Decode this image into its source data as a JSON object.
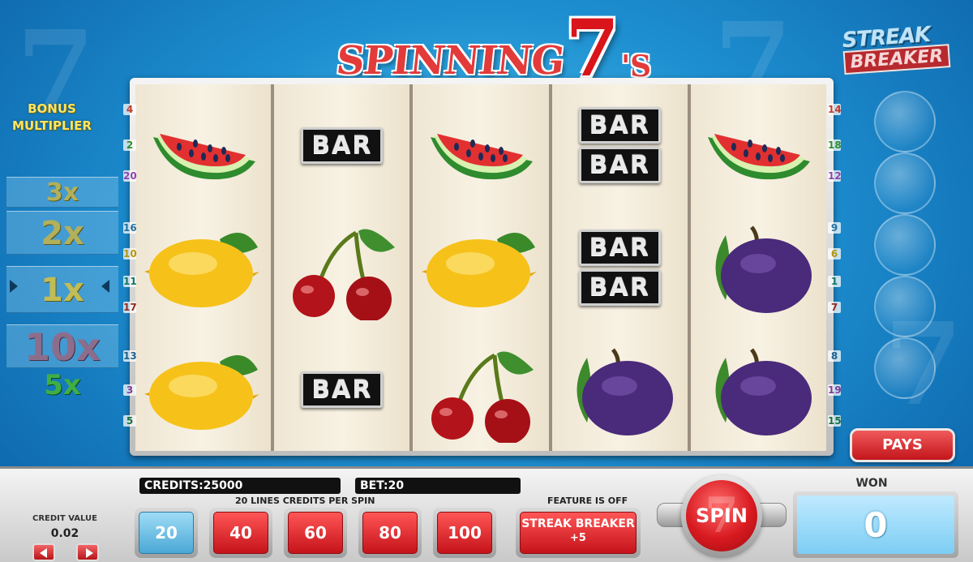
{
  "game": {
    "title_word": "SPINNING",
    "title_seven": "7",
    "title_suffix": "'S",
    "streak_logo_line1": "STREAK",
    "streak_logo_line2": "BREAKER"
  },
  "bonus": {
    "title_line1": "BONUS",
    "title_line2": "MULTIPLIER",
    "multipliers": [
      "3x",
      "2x",
      "1x",
      "10x",
      "5x"
    ],
    "active": "1x"
  },
  "reels": [
    [
      "watermelon",
      "lemon",
      "lemon"
    ],
    [
      "bar",
      "cherries",
      "bar"
    ],
    [
      "watermelon",
      "lemon",
      "cherries"
    ],
    [
      "double-bar",
      "double-bar",
      "plum"
    ],
    [
      "watermelon",
      "plum",
      "plum"
    ]
  ],
  "bar_text": "BAR",
  "paylines": {
    "left": [
      "4",
      "2",
      "20",
      "16",
      "10",
      "11",
      "17",
      "13",
      "3",
      "5"
    ],
    "right": [
      "14",
      "18",
      "12",
      "9",
      "6",
      "1",
      "7",
      "8",
      "19",
      "15"
    ]
  },
  "pays_label": "PAYS",
  "panel": {
    "credits": "CREDITS:25000",
    "bet": "BET:20",
    "lines_label": "20 LINES CREDITS PER SPIN",
    "credit_value_label": "CREDIT VALUE",
    "credit_value": "0.02",
    "bet_options": [
      "20",
      "40",
      "60",
      "80",
      "100"
    ],
    "active_bet": "20",
    "feature_label": "FEATURE IS OFF",
    "streak_button": "STREAK BREAKER",
    "streak_button_sub": "+5",
    "spin_label": "SPIN",
    "spin_bg_glyph": "7",
    "won_label": "WON",
    "won_value": "0"
  },
  "colors": {
    "accent_red": "#d81a20",
    "sky_blue": "#1d8fd0",
    "multiplier_gold": "#ffe562"
  }
}
